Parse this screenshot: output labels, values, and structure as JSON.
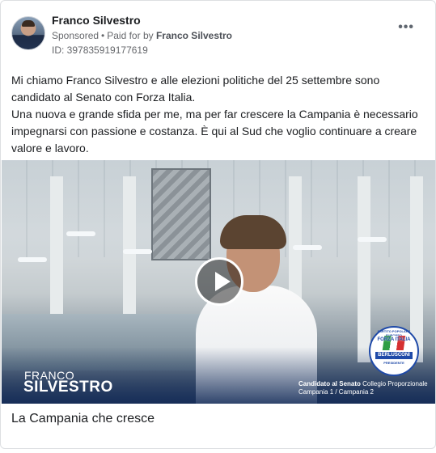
{
  "header": {
    "author": "Franco Silvestro",
    "sponsored": "Sponsored",
    "paid_prefix": "Paid for by",
    "paid_by": "Franco Silvestro",
    "id_text": "ID: 397835919177619",
    "more_label": "•••"
  },
  "body": {
    "paragraph1": "Mi chiamo Franco Silvestro e alle elezioni politiche del 25 settembre sono candidato al Senato con Forza Italia.",
    "paragraph2": "Una nuova e grande sfida per me, ma per far crescere la Campania è necessario impegnarsi con passione e costanza. È qui al Sud che voglio continuare a creare valore e lavoro."
  },
  "video": {
    "name_first": "FRANCO",
    "name_last": "SILVESTRO",
    "cand_bold": "Candidato al Senato",
    "cand_rest": "Collegio Proporzionale",
    "cand_line2": "Campania 1 / Campania 2",
    "logo_ring": "PARTITO POPOLARE EUROPEO",
    "logo_forza": "FORZA ITALIA",
    "logo_berlusconi": "BERLUSCONI",
    "logo_presidente": "PRESIDENTE"
  },
  "caption": "La Campania che cresce",
  "colors": {
    "text_primary": "#1c1e21",
    "text_secondary": "#65676b",
    "brand_blue": "#1f4aa8",
    "border": "#dddfe2"
  },
  "icons": {
    "more": "more-horizontal-icon",
    "play": "play-icon"
  }
}
